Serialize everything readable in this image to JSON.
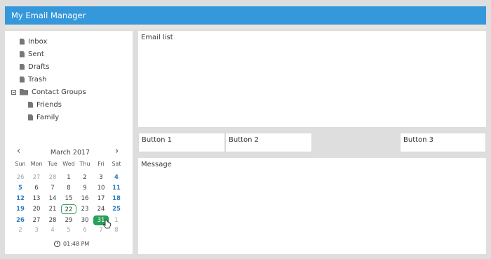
{
  "header": {
    "title": "My Email Manager"
  },
  "tree": {
    "items": [
      {
        "label": "Inbox"
      },
      {
        "label": "Sent"
      },
      {
        "label": "Drafts"
      },
      {
        "label": "Trash"
      }
    ],
    "group": {
      "label": "Contact Groups",
      "children": [
        {
          "label": "Friends"
        },
        {
          "label": "Family"
        }
      ]
    }
  },
  "calendar": {
    "month_label": "March 2017",
    "prev_icon": "chevron-left-icon",
    "next_icon": "chevron-right-icon",
    "weekdays": [
      "Sun",
      "Mon",
      "Tue",
      "Wed",
      "Thu",
      "Fri",
      "Sat"
    ],
    "weeks": [
      [
        "26",
        "27",
        "28",
        "1",
        "2",
        "3",
        "4"
      ],
      [
        "5",
        "6",
        "7",
        "8",
        "9",
        "10",
        "11"
      ],
      [
        "12",
        "13",
        "14",
        "15",
        "16",
        "17",
        "18"
      ],
      [
        "19",
        "20",
        "21",
        "22",
        "23",
        "24",
        "25"
      ],
      [
        "26",
        "27",
        "28",
        "29",
        "30",
        "31",
        "1"
      ],
      [
        "2",
        "3",
        "4",
        "5",
        "6",
        "7",
        "8"
      ]
    ],
    "today": "22",
    "selected": "31",
    "time": "01:48 PM"
  },
  "panes": {
    "email_list": "Email list",
    "message": "Message"
  },
  "buttons": {
    "b1": "Button 1",
    "b2": "Button 2",
    "b3": "Button 3"
  },
  "colors": {
    "accent": "#3498db",
    "selected": "#27a05a",
    "weekend": "#2a7bbf"
  }
}
